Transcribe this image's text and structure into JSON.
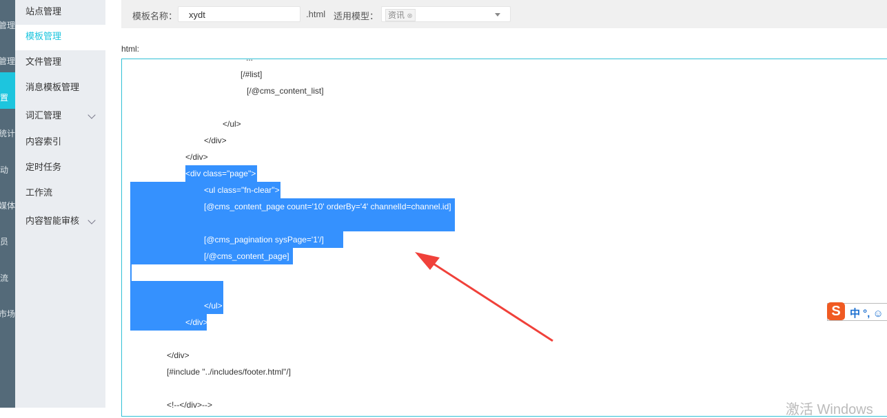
{
  "rail": {
    "items": [
      "管理",
      "管理",
      "置",
      "统计",
      "动",
      "媒体",
      "员",
      "流",
      "市场"
    ]
  },
  "sidebar": {
    "items": [
      {
        "label": "站点管理"
      },
      {
        "label": "模板管理",
        "active": true
      },
      {
        "label": "文件管理"
      },
      {
        "label": "消息模板管理"
      },
      {
        "label": "词汇管理",
        "expandable": true
      },
      {
        "label": "内容索引"
      },
      {
        "label": "定时任务"
      },
      {
        "label": "工作流"
      },
      {
        "label": "内容智能审核",
        "expandable": true
      }
    ]
  },
  "form": {
    "name_label": "模板名称：",
    "name_value": "xydt",
    "suffix": ".html",
    "model_label": "适用模型：",
    "model_tag": "资讯",
    "tag_remove": "⊗"
  },
  "editor": {
    "label": "html:",
    "lines": [
      "...",
      "[/#list]",
      "[/@cms_content_list]",
      "",
      "</ul>",
      "</div>",
      "</div>",
      "<div class=\"page\">",
      "<ul class=\"fn-clear\">",
      "[@cms_content_page count='10' orderBy='4' channelId=channel.id]",
      "",
      "[@cms_pagination sysPage='1'/]",
      "[/@cms_content_page]",
      "",
      "",
      "</ul>",
      "</div>",
      "",
      "</div>",
      "[#include \"../includes/footer.html\"/]",
      "",
      "<!--</div>-->"
    ]
  },
  "ime": {
    "logo": "S",
    "text": "中 °, ☺"
  },
  "watermark": "激活 Windows",
  "colors": {
    "accent": "#1dc5de",
    "selection": "#3591fe",
    "arrow": "#f0413a"
  }
}
